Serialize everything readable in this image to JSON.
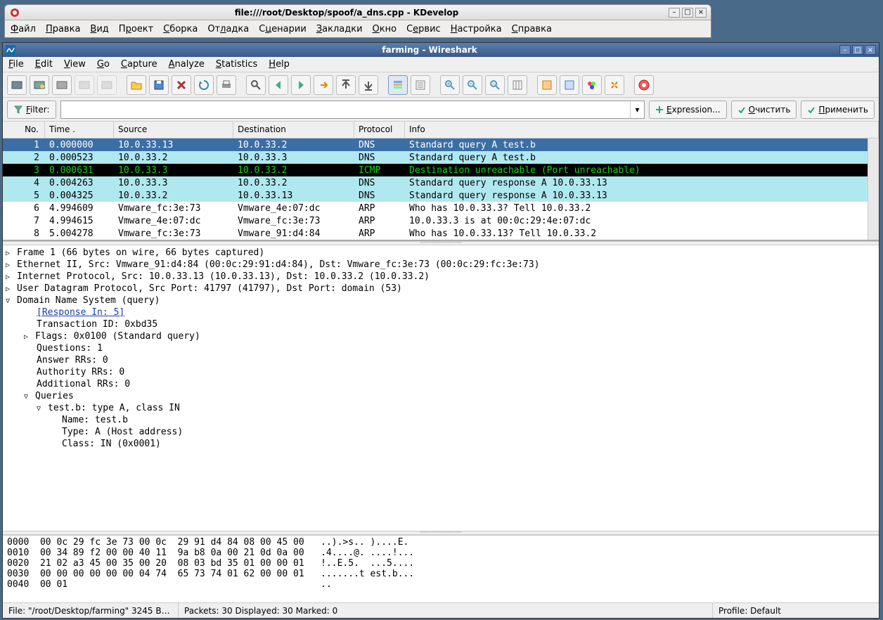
{
  "kdevelop": {
    "title": "file:///root/Desktop/spoof/a_dns.cpp - KDevelop",
    "menu": [
      "Файл",
      "Правка",
      "Вид",
      "Проект",
      "Сборка",
      "Отладка",
      "Сценарии",
      "Закладки",
      "Окно",
      "Сервис",
      "Настройка",
      "Справка"
    ]
  },
  "wireshark": {
    "title": "farming - Wireshark",
    "menu": [
      "File",
      "Edit",
      "View",
      "Go",
      "Capture",
      "Analyze",
      "Statistics",
      "Help"
    ],
    "filterbar": {
      "label": "Filter:",
      "value": "",
      "expr_btn": "Expression...",
      "clear_btn": "Очистить",
      "apply_btn": "Применить"
    },
    "columns": [
      "No.",
      "Time .",
      "Source",
      "Destination",
      "Protocol",
      "Info"
    ],
    "packets": [
      {
        "no": "1",
        "time": "0.000000",
        "src": "10.0.33.13",
        "dst": "10.0.33.2",
        "proto": "DNS",
        "info": "Standard query A test.b",
        "cls": "sel"
      },
      {
        "no": "2",
        "time": "0.000523",
        "src": "10.0.33.2",
        "dst": "10.0.33.3",
        "proto": "DNS",
        "info": "Standard query A test.b",
        "cls": "cyan"
      },
      {
        "no": "3",
        "time": "0.000631",
        "src": "10.0.33.3",
        "dst": "10.0.33.2",
        "proto": "ICMP",
        "info": "Destination unreachable (Port unreachable)",
        "cls": "black"
      },
      {
        "no": "4",
        "time": "0.004263",
        "src": "10.0.33.3",
        "dst": "10.0.33.2",
        "proto": "DNS",
        "info": "Standard query response A 10.0.33.13",
        "cls": "cyan"
      },
      {
        "no": "5",
        "time": "0.004325",
        "src": "10.0.33.2",
        "dst": "10.0.33.13",
        "proto": "DNS",
        "info": "Standard query response A 10.0.33.13",
        "cls": "cyan"
      },
      {
        "no": "6",
        "time": "4.994609",
        "src": "Vmware_fc:3e:73",
        "dst": "Vmware_4e:07:dc",
        "proto": "ARP",
        "info": "Who has 10.0.33.3?  Tell 10.0.33.2",
        "cls": "plain"
      },
      {
        "no": "7",
        "time": "4.994615",
        "src": "Vmware_4e:07:dc",
        "dst": "Vmware_fc:3e:73",
        "proto": "ARP",
        "info": "10.0.33.3 is at 00:0c:29:4e:07:dc",
        "cls": "plain"
      },
      {
        "no": "8",
        "time": "5.004278",
        "src": "Vmware_fc:3e:73",
        "dst": "Vmware_91:d4:84",
        "proto": "ARP",
        "info": "Who has 10.0.33.13?  Tell 10.0.33.2",
        "cls": "plain"
      }
    ],
    "details": {
      "frame": "Frame 1 (66 bytes on wire, 66 bytes captured)",
      "eth": "Ethernet II, Src: Vmware_91:d4:84 (00:0c:29:91:d4:84), Dst: Vmware_fc:3e:73 (00:0c:29:fc:3e:73)",
      "ip": "Internet Protocol, Src: 10.0.33.13 (10.0.33.13), Dst: 10.0.33.2 (10.0.33.2)",
      "udp": "User Datagram Protocol, Src Port: 41797 (41797), Dst Port: domain (53)",
      "dns": "Domain Name System (query)",
      "resp_in": "[Response In: 5]",
      "txid": "Transaction ID: 0xbd35",
      "flags": "Flags: 0x0100 (Standard query)",
      "questions": "Questions: 1",
      "answers": "Answer RRs: 0",
      "authority": "Authority RRs: 0",
      "additional": "Additional RRs: 0",
      "queries": "Queries",
      "query": "test.b: type A, class IN",
      "name": "Name: test.b",
      "type": "Type: A (Host address)",
      "class": "Class: IN (0x0001)"
    },
    "hex": [
      "0000  00 0c 29 fc 3e 73 00 0c  29 91 d4 84 08 00 45 00   ..).>s.. )....E.",
      "0010  00 34 89 f2 00 00 40 11  9a b8 0a 00 21 0d 0a 00   .4....@. ....!...",
      "0020  21 02 a3 45 00 35 00 20  08 03 bd 35 01 00 00 01   !..E.5.  ...5....",
      "0030  00 00 00 00 00 00 04 74  65 73 74 01 62 00 00 01   .......t est.b...",
      "0040  00 01                                              .."
    ],
    "status": {
      "file": "File: \"/root/Desktop/farming\" 3245 B…",
      "packets": "Packets: 30 Displayed: 30 Marked: 0",
      "profile": "Profile: Default"
    }
  }
}
